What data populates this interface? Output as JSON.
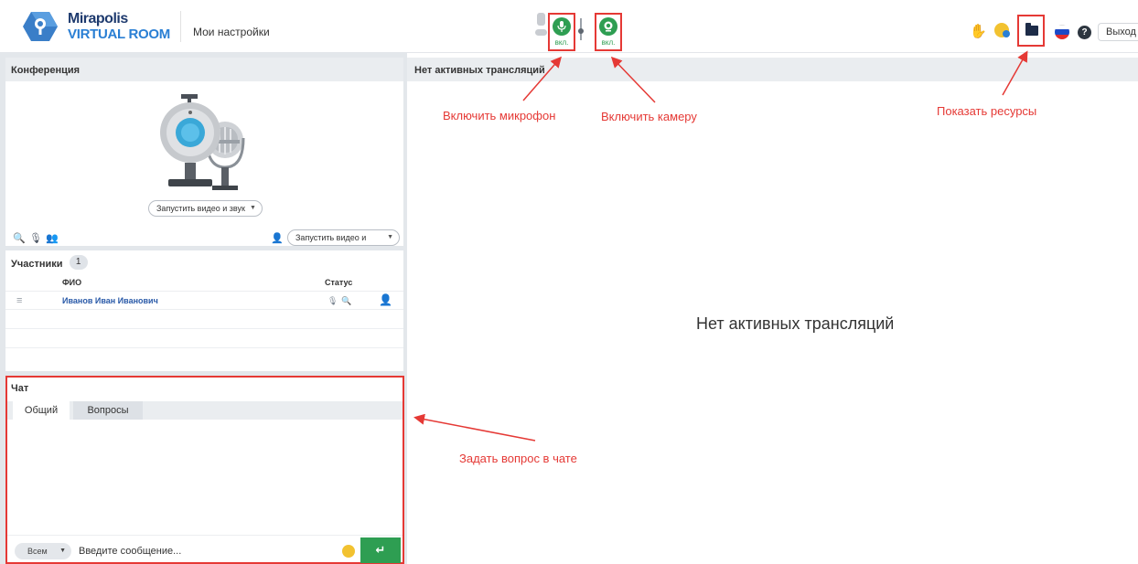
{
  "header": {
    "logo_line1": "Mirapolis",
    "logo_line2": "VIRTUAL ROOM",
    "settings_link": "Мои настройки",
    "mic_button_label": "вкл.",
    "cam_button_label": "вкл.",
    "exit_label": "Выход"
  },
  "conference": {
    "title": "Конференция",
    "start_av_label": "Запустить видео и звук",
    "start_av_label_2": "Запустить видео и звук"
  },
  "participants": {
    "title": "Участники",
    "count": "1",
    "col_name": "ФИО",
    "col_status": "Статус",
    "rows": [
      {
        "name": "Иванов Иван Иванович"
      }
    ]
  },
  "chat": {
    "title": "Чат",
    "tabs": [
      "Общий",
      "Вопросы"
    ],
    "recipient": "Всем",
    "input_placeholder": "Введите сообщение..."
  },
  "broadcast": {
    "header": "Нет активных трансляций",
    "empty_message": "Нет активных трансляций"
  },
  "annotations": {
    "mic": "Включить микрофон",
    "camera": "Включить камеру",
    "resources": "Показать ресурсы",
    "chat": "Задать вопрос в чате"
  },
  "colors": {
    "accent_green": "#2e9e52",
    "annotation_red": "#e53935",
    "brand_blue": "#2a7fd4"
  }
}
